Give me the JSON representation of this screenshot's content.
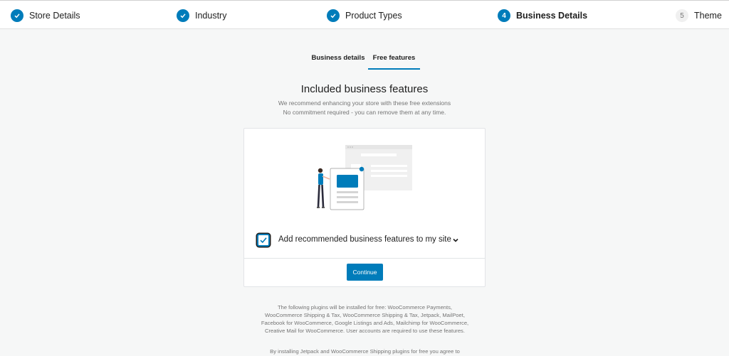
{
  "stepper": {
    "steps": [
      {
        "label": "Store Details",
        "number": "1",
        "status": "done"
      },
      {
        "label": "Industry",
        "number": "2",
        "status": "done"
      },
      {
        "label": "Product Types",
        "number": "3",
        "status": "done"
      },
      {
        "label": "Business Details",
        "number": "4",
        "status": "current"
      },
      {
        "label": "Theme",
        "number": "5",
        "status": "pending"
      }
    ]
  },
  "tabs": [
    {
      "label": "Business details",
      "active": false
    },
    {
      "label": "Free features",
      "active": true
    }
  ],
  "main": {
    "title": "Included business features",
    "subtitle_line1": "We recommend enhancing your store with these free extensions",
    "subtitle_line2": "No commitment required - you can remove them at any time."
  },
  "card": {
    "checkbox_label": "Add recommended business features to my site",
    "checkbox_checked": true,
    "continue_label": "Continue"
  },
  "footer": {
    "plugins_note": "The following plugins will be installed for free: WooCommerce Payments, WooCommerce Shipping & Tax, WooCommerce Shipping & Tax, Jetpack, MailPoet, Facebook for WooCommerce, Google Listings and Ads, Mailchimp for WooCommerce, Creative Mail for WooCommerce. User accounts are required to use these features.",
    "tos_note": "By installing Jetpack and WooCommerce Shipping plugins for free you agree to"
  },
  "colors": {
    "accent": "#007cba",
    "background": "#f6f7f7",
    "text_muted": "#757575"
  }
}
